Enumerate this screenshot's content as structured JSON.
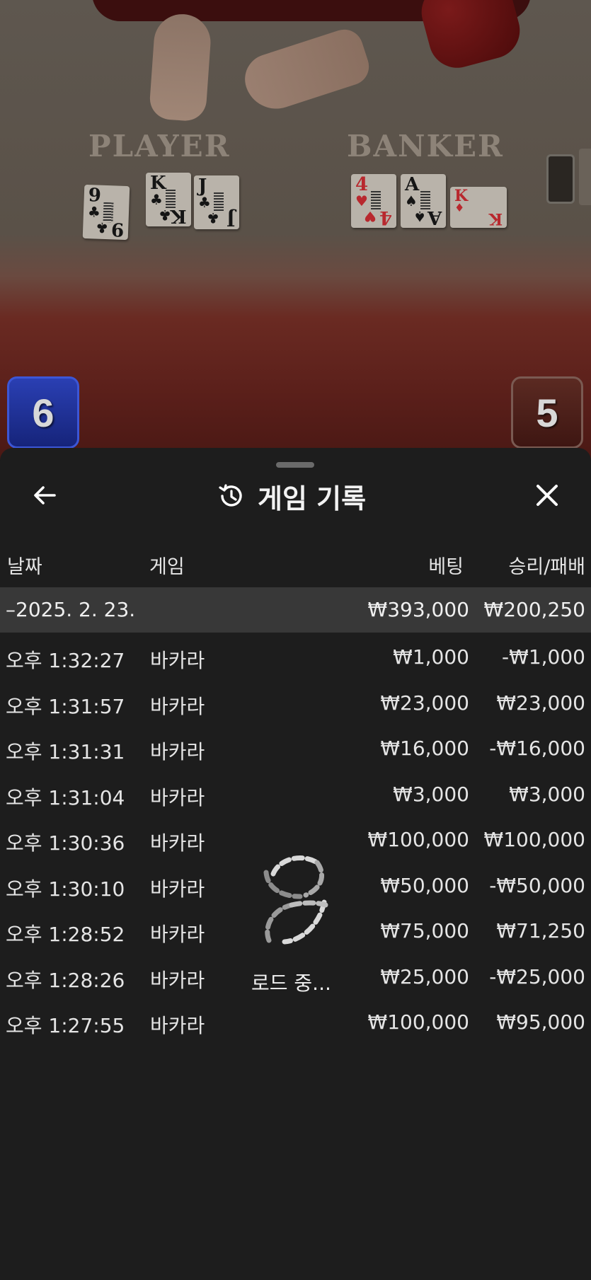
{
  "video": {
    "player_label": "PLAYER",
    "banker_label": "BANKER",
    "player_score": "6",
    "banker_score": "5",
    "player_cards": [
      {
        "rank": "9",
        "suit": "♣",
        "color": "black"
      },
      {
        "rank": "K",
        "suit": "♣",
        "color": "black"
      },
      {
        "rank": "J",
        "suit": "♣",
        "color": "black"
      }
    ],
    "banker_cards": [
      {
        "rank": "4",
        "suit": "♥",
        "color": "red"
      },
      {
        "rank": "A",
        "suit": "♠",
        "color": "black"
      },
      {
        "rank": "K",
        "suit": "♦",
        "color": "red"
      }
    ],
    "colors": {
      "player": "#1f34a6",
      "banker": "#4a1c16"
    }
  },
  "header": {
    "title": "게임 기록",
    "back_icon": "arrow-left-icon",
    "history_icon": "history-icon",
    "close_icon": "close-icon"
  },
  "columns": {
    "date": "날짜",
    "game": "게임",
    "bet": "베팅",
    "win_loss": "승리/패배"
  },
  "date_group": {
    "date": "–2025. 2. 23.",
    "bet_total": "₩393,000",
    "win_total": "₩200,250"
  },
  "rows": [
    {
      "time": "오후 1:32:27",
      "game": "바카라",
      "bet": "₩1,000",
      "result": "-₩1,000"
    },
    {
      "time": "오후 1:31:57",
      "game": "바카라",
      "bet": "₩23,000",
      "result": "₩23,000"
    },
    {
      "time": "오후 1:31:31",
      "game": "바카라",
      "bet": "₩16,000",
      "result": "-₩16,000"
    },
    {
      "time": "오후 1:31:04",
      "game": "바카라",
      "bet": "₩3,000",
      "result": "₩3,000"
    },
    {
      "time": "오후 1:30:36",
      "game": "바카라",
      "bet": "₩100,000",
      "result": "₩100,000"
    },
    {
      "time": "오후 1:30:10",
      "game": "바카라",
      "bet": "₩50,000",
      "result": "-₩50,000"
    },
    {
      "time": "오후 1:28:52",
      "game": "바카라",
      "bet": "₩75,000",
      "result": "₩71,250"
    },
    {
      "time": "오후 1:28:26",
      "game": "바카라",
      "bet": "₩25,000",
      "result": "-₩25,000"
    },
    {
      "time": "오후 1:27:55",
      "game": "바카라",
      "bet": "₩100,000",
      "result": "₩95,000"
    }
  ],
  "loading": {
    "text": "로드 중...",
    "icon": "loading-spinner-icon"
  }
}
